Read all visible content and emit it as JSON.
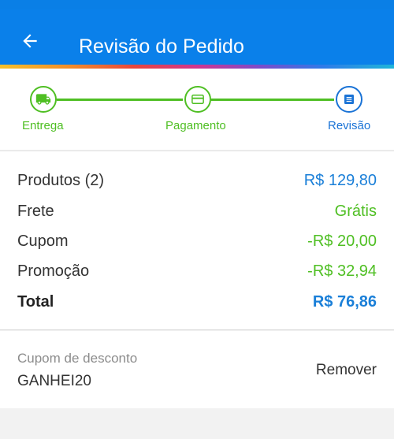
{
  "header": {
    "title": "Revisão do Pedido",
    "colors": {
      "appbar": "#0a80ea",
      "accent_green": "#4fbf23",
      "accent_blue": "#1a73d6"
    }
  },
  "stepper": {
    "steps": [
      {
        "label": "Entrega",
        "icon": "truck-icon",
        "state": "done"
      },
      {
        "label": "Pagamento",
        "icon": "card-icon",
        "state": "done"
      },
      {
        "label": "Revisão",
        "icon": "document-icon",
        "state": "current"
      }
    ]
  },
  "summary": {
    "rows": [
      {
        "label": "Produtos (2)",
        "value": "R$ 129,80"
      },
      {
        "label": "Frete",
        "value": "Grátis"
      },
      {
        "label": "Cupom",
        "value": "-R$ 20,00"
      },
      {
        "label": "Promoção",
        "value": "-R$ 32,94"
      },
      {
        "label": "Total",
        "value": "R$ 76,86"
      }
    ]
  },
  "coupon": {
    "label": "Cupom de desconto",
    "code": "GANHEI20",
    "remove_label": "Remover"
  }
}
